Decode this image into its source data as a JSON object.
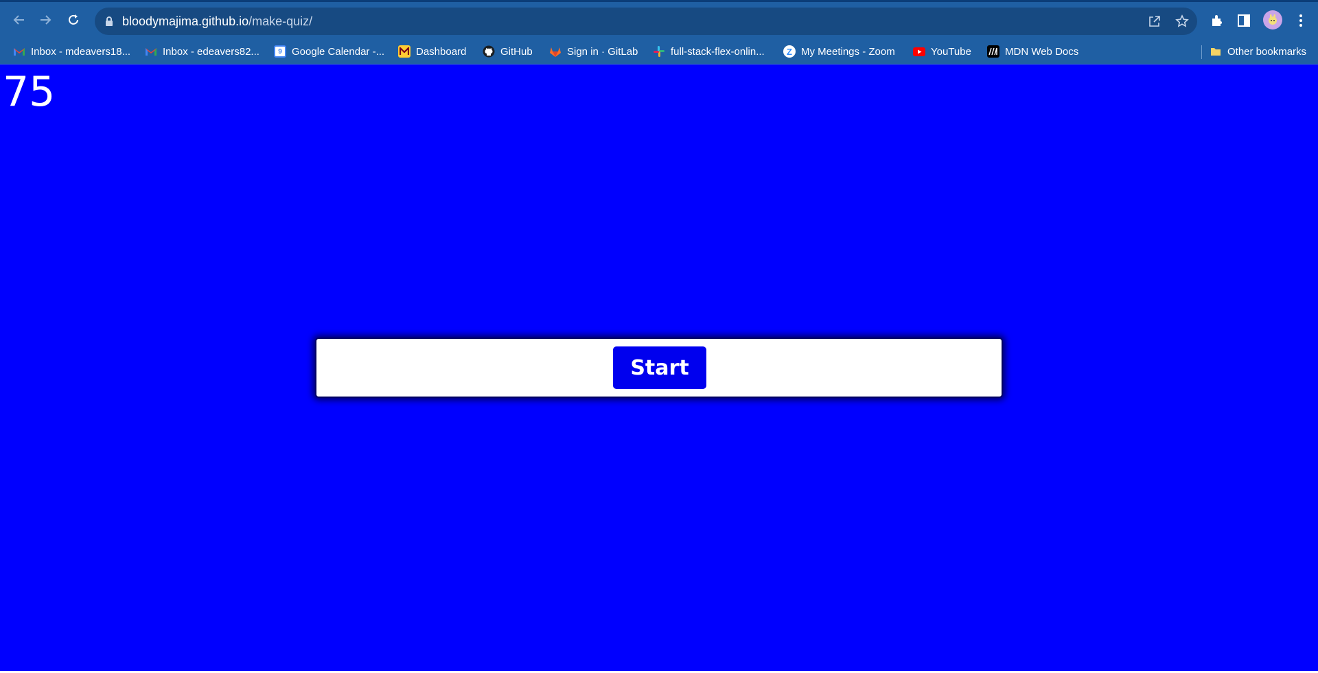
{
  "browser": {
    "url_host": "bloodymajima.github.io",
    "url_path": "/make-quiz/",
    "bookmarks": [
      {
        "label": "Inbox - mdeavers18...",
        "icon": "gmail-icon"
      },
      {
        "label": "Inbox - edeavers82...",
        "icon": "gmail-icon"
      },
      {
        "label": "Google Calendar -...",
        "icon": "google-calendar-icon"
      },
      {
        "label": "Dashboard",
        "icon": "umn-icon"
      },
      {
        "label": "GitHub",
        "icon": "github-icon"
      },
      {
        "label": "Sign in · GitLab",
        "icon": "gitlab-icon"
      },
      {
        "label": "full-stack-flex-onlin...",
        "icon": "slack-icon"
      },
      {
        "label": "My Meetings - Zoom",
        "icon": "zoom-icon"
      },
      {
        "label": "YouTube",
        "icon": "youtube-icon"
      },
      {
        "label": "MDN Web Docs",
        "icon": "mdn-icon"
      }
    ],
    "other_bookmarks": "Other bookmarks",
    "calendar_day": "9"
  },
  "page": {
    "timer": "75",
    "start_label": "Start",
    "background_color": "#0000ff",
    "button_color": "#0000ee"
  }
}
